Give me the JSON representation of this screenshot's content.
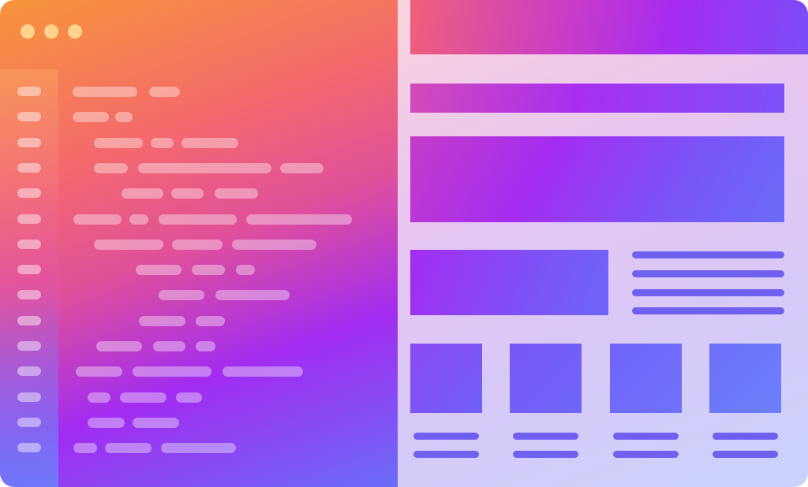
{
  "colors": {
    "editor_gradient": [
      "#f7953a",
      "#f46a6c",
      "#e0509a",
      "#a12cf0",
      "#6b6cf8"
    ],
    "preview_background": [
      "#fbd3de",
      "#e8c6f0",
      "#c9d3fc"
    ],
    "preview_accent": "#7060f0"
  },
  "editor": {
    "window_controls": [
      "close",
      "minimize",
      "maximize"
    ]
  },
  "preview": {
    "card_count": 4
  }
}
